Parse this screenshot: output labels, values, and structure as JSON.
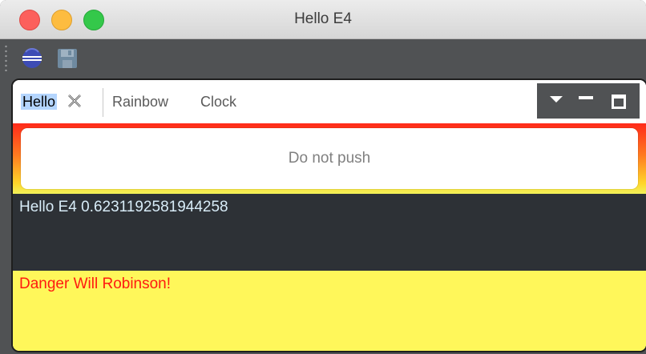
{
  "window": {
    "title": "Hello E4",
    "traffic_lights": [
      "close",
      "minimize",
      "zoom"
    ]
  },
  "toolbar": {
    "buttons": [
      {
        "icon": "eclipse-icon",
        "color": "#3d4cb5"
      },
      {
        "icon": "save-icon",
        "color": "#6f8aa0",
        "disabled": true
      }
    ]
  },
  "tabs": [
    {
      "label": "Hello",
      "active": true,
      "closable": true
    },
    {
      "label": "Rainbow",
      "active": false
    },
    {
      "label": "Clock",
      "active": false
    }
  ],
  "stack_tools": [
    "view-menu-icon",
    "minimize-icon",
    "maximize-icon"
  ],
  "content": {
    "button_label": "Do not push",
    "label_dark": "Hello E4 0.6231192581944258",
    "label_yellow": "Danger Will Robinson!"
  },
  "colors": {
    "dark_label_bg": "#2d3136",
    "dark_label_fg": "#d8ecf8",
    "warning_bg": "#fff75a",
    "warning_fg": "#ff1a10",
    "gradient_top": "#ff2a1a",
    "gradient_bottom": "#f2f25a"
  }
}
